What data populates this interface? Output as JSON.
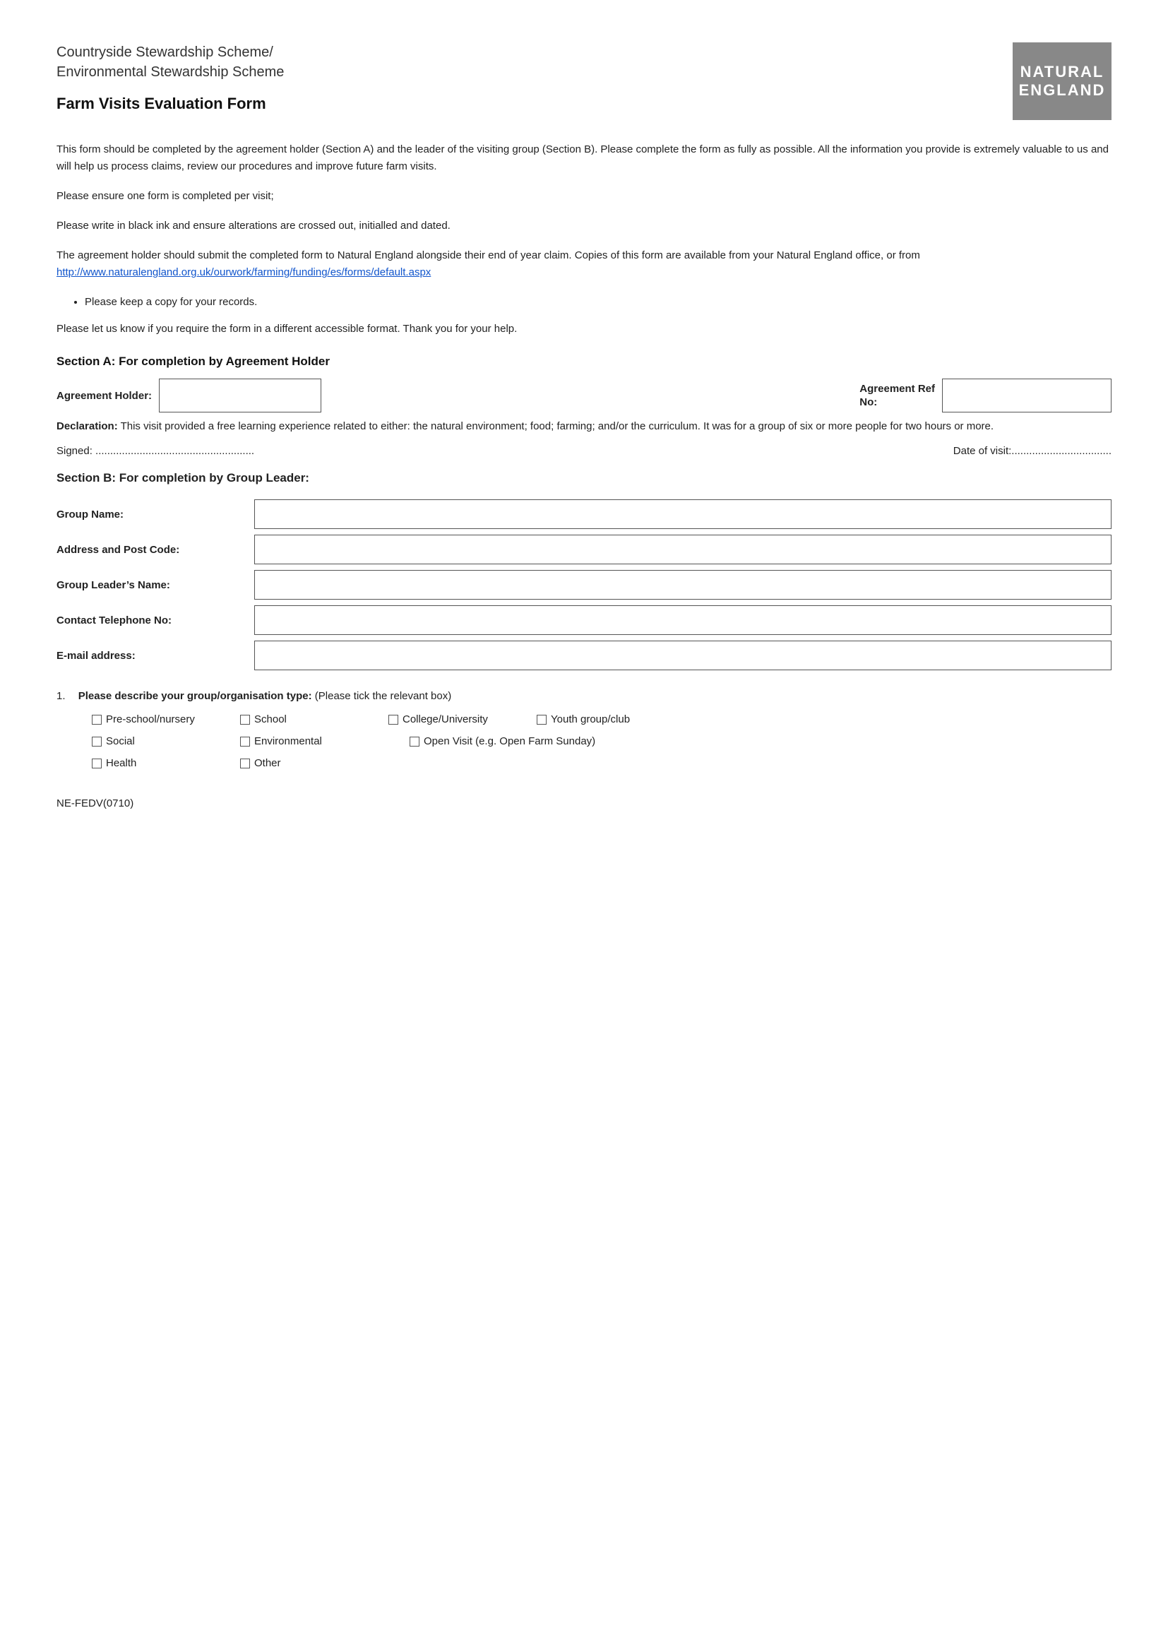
{
  "header": {
    "org_title_line1": "Countryside Stewardship Scheme/",
    "org_title_line2": "Environmental Stewardship Scheme",
    "form_title": "Farm Visits Evaluation Form",
    "logo_line1": "NATURAL",
    "logo_line2": "ENGLAND"
  },
  "intro": {
    "paragraph1": "This form should be completed by the agreement holder (Section A) and the leader of the visiting group (Section B). Please complete the form as fully as possible.  All the information you provide is extremely valuable to us and will help us process claims, review our procedures and improve future farm visits.",
    "paragraph2": "Please ensure one form is completed per visit;",
    "paragraph3": "Please write in black ink and ensure alterations are crossed out, initialled and dated.",
    "paragraph4": "The agreement holder should submit the completed form to Natural England alongside their end of year claim. Copies of this form are available from your Natural England office, or from",
    "link_text": "http://www.naturalengland.org.uk/ourwork/farming/funding/es/forms/default.aspx",
    "bullet1": "Please keep a copy for your records.",
    "paragraph5": "Please let us know if you require the form in a different accessible format. Thank you for your help."
  },
  "section_a": {
    "heading": "Section A: For completion by Agreement Holder",
    "agreement_holder_label": "Agreement Holder:",
    "agreement_ref_label_line1": "Agreement Ref",
    "agreement_ref_label_line2": "No:",
    "declaration_bold": "Declaration:",
    "declaration_text": " This visit provided a free learning experience related to either: the natural environment; food; farming; and/or the curriculum. It was for a group of six or more people for two hours or more.",
    "signed_label": "Signed: ......................................................",
    "date_label": "Date of visit:.................................."
  },
  "section_b": {
    "heading": "Section B: For completion by Group Leader:",
    "group_name_label": "Group Name:",
    "address_label": "Address and Post Code:",
    "group_leader_label": "Group Leader’s Name:",
    "contact_tel_label": "Contact Telephone No:",
    "email_label": "E-mail address:"
  },
  "question1": {
    "number": "1.",
    "label_bold": "Please describe your group/organisation type:",
    "label_normal": " (Please tick the relevant box)",
    "checkboxes": [
      [
        "Pre-school/nursery",
        "School",
        "College/University",
        "Youth group/club"
      ],
      [
        "Social",
        "Environmental",
        "Open Visit (e.g. Open Farm Sunday)"
      ],
      [
        "Health",
        "Other"
      ]
    ]
  },
  "footer": {
    "code": "NE-FEDV(0710)"
  }
}
